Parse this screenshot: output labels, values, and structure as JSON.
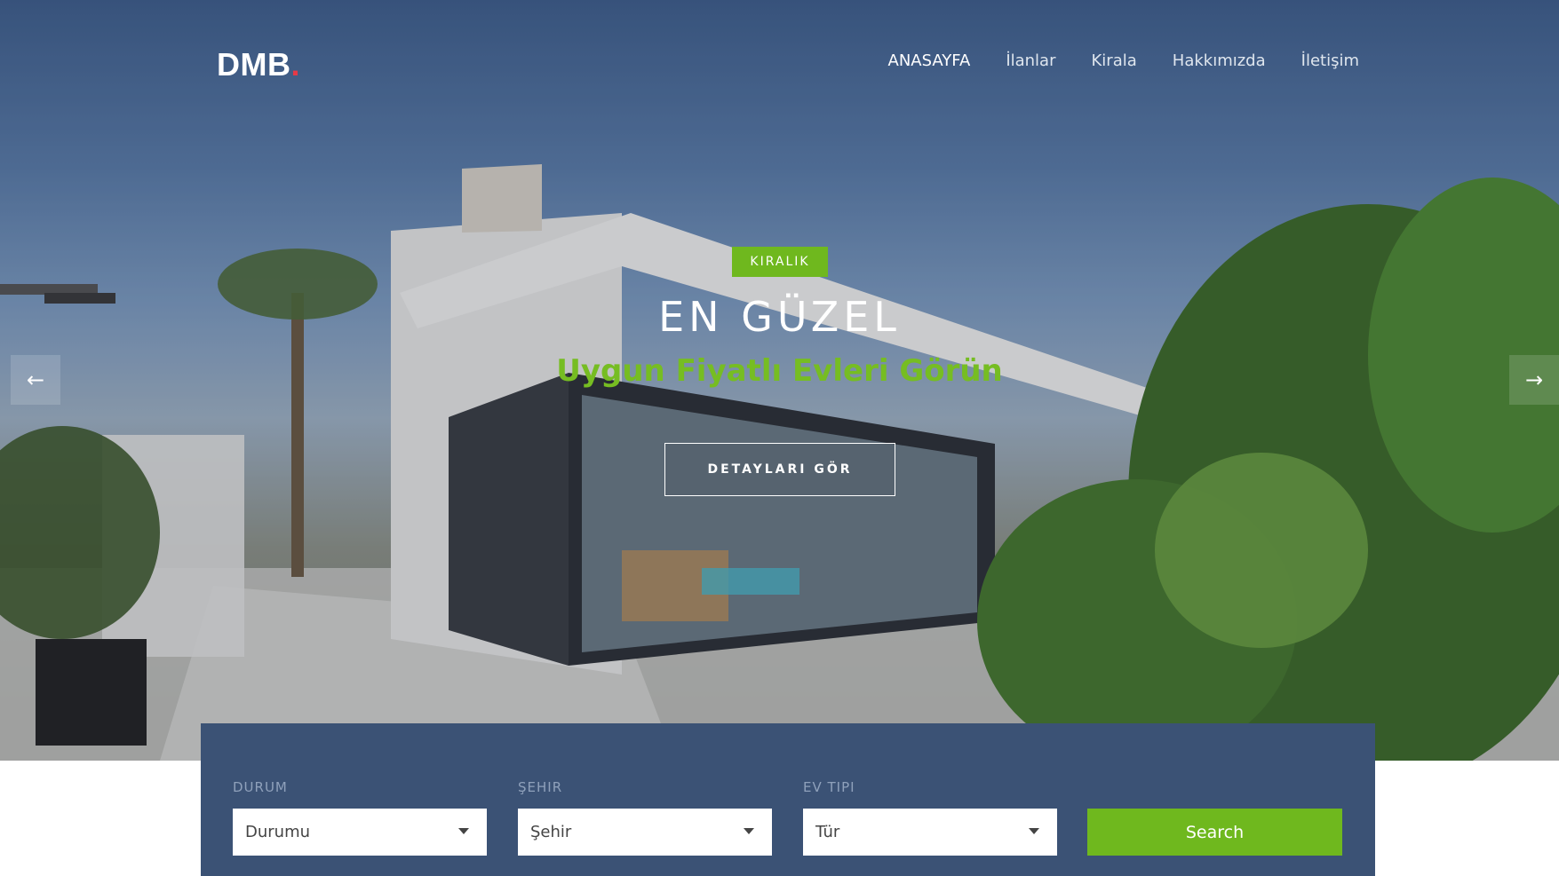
{
  "header": {
    "logo_text": "DMB",
    "logo_dot": ".",
    "nav": [
      {
        "label": "ANASAYFA",
        "active": true
      },
      {
        "label": "İlanlar",
        "active": false
      },
      {
        "label": "Kirala",
        "active": false
      },
      {
        "label": "Hakkımızda",
        "active": false
      },
      {
        "label": "İletişim",
        "active": false
      }
    ]
  },
  "hero": {
    "badge": "KIRALIK",
    "headline": "EN GÜZEL",
    "subheadline": "Uygun Fiyatlı Evleri Görün",
    "cta_label": "DETAYLARI GÖR",
    "prev_icon": "arrow-left-icon",
    "next_icon": "arrow-right-icon"
  },
  "search": {
    "fields": [
      {
        "label": "DURUM",
        "value": "Durumu"
      },
      {
        "label": "ŞEHIR",
        "value": "Şehir"
      },
      {
        "label": "EV TIPI",
        "value": "Tür"
      }
    ],
    "button_label": "Search"
  },
  "colors": {
    "accent_green": "#6fb81e",
    "panel_navy": "#3b5275",
    "logo_dot_red": "#e63946"
  }
}
